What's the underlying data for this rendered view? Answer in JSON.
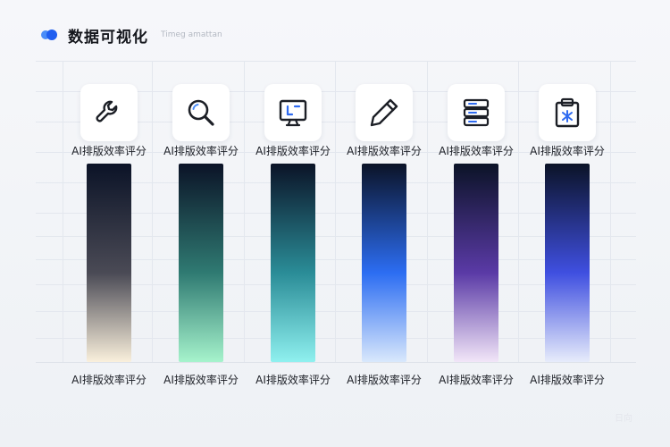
{
  "header": {
    "title": "数据可视化",
    "subtitle": "Timeg amattan",
    "accent_colors": [
      "#4a8df8",
      "#1f5ef0"
    ]
  },
  "watermark": "日向",
  "chart_data": {
    "type": "bar",
    "title": "数据可视化",
    "xlabel": "",
    "ylabel": "",
    "categories": [
      "AI排版效率评分",
      "AI排版效率评分",
      "AI排版效率评分",
      "AI排版效率评分",
      "AI排版效率评分",
      "AI排版效率评分"
    ],
    "values": [
      100,
      100,
      100,
      100,
      100,
      100
    ],
    "ylim": [
      0,
      100
    ],
    "grid": true,
    "legend": "none",
    "icons": [
      "wrench-icon",
      "search-icon",
      "monitor-icon",
      "pencil-icon",
      "server-icon",
      "clipboard-icon"
    ],
    "bar_gradients": [
      [
        "#0b1327",
        "#4a4a55",
        "#faf0dc"
      ],
      [
        "#0b1327",
        "#2f7a72",
        "#a6f3cc"
      ],
      [
        "#0b1327",
        "#2a8c97",
        "#8ff0ef"
      ],
      [
        "#0b1327",
        "#2c6df2",
        "#d9e8fc"
      ],
      [
        "#0b1327",
        "#5a3aa6",
        "#f2e6f8"
      ],
      [
        "#0b1327",
        "#3f4fe0",
        "#e7ecfb"
      ]
    ]
  }
}
